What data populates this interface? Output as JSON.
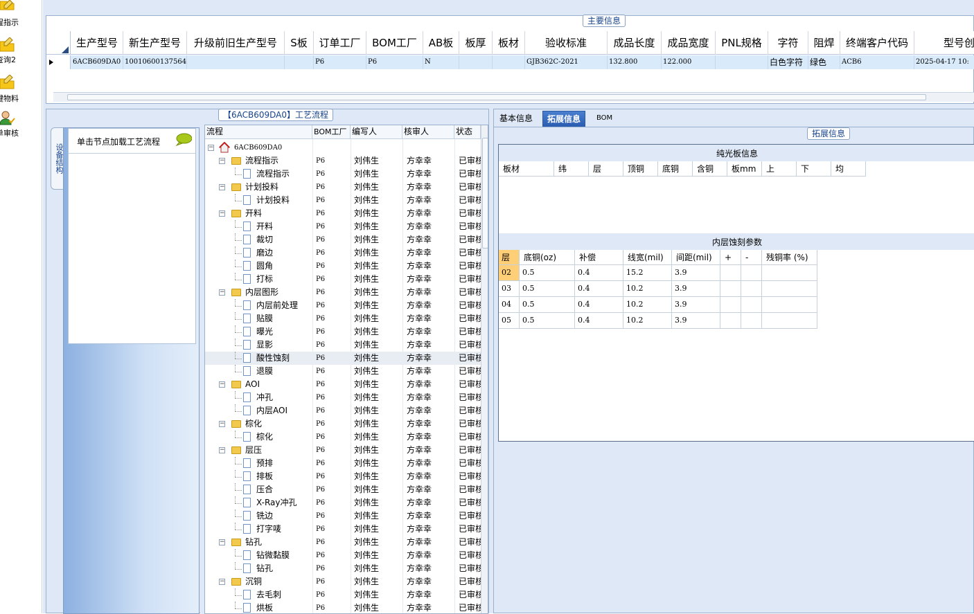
{
  "left_nav": {
    "items": [
      {
        "label": "程指示",
        "icon": "folder-pencil-icon"
      },
      {
        "label": "查询2",
        "icon": "folder-pencil-icon"
      },
      {
        "label": "键物料",
        "icon": "folder-pencil-icon"
      },
      {
        "label": "单审核",
        "icon": "user-check-icon"
      }
    ]
  },
  "main_info": {
    "title": "主要信息",
    "columns": [
      "生产型号",
      "新生产型号",
      "升级前旧生产型号",
      "S板",
      "订单工厂",
      "BOM工厂",
      "AB板",
      "板厚",
      "板材",
      "验收标准",
      "成品长度",
      "成品宽度",
      "PNL规格",
      "字符",
      "阻焊",
      "终端客户代码",
      "型号创"
    ],
    "row": [
      "6ACB609DA0",
      "10010600137564",
      "",
      "",
      "P6",
      "P6",
      "N",
      "",
      "",
      "GJB362C-2021",
      "132.800",
      "122.000",
      "",
      "白色字符",
      "绿色",
      "ACB6",
      "2025-04-17 10:"
    ]
  },
  "process_panel": {
    "title": "【6ACB609DA0】工艺流程",
    "side_tab": "设备结构",
    "hint": "单击节点加载工艺流程",
    "columns": [
      "流程",
      "BOM工厂",
      "编写人",
      "核审人",
      "状态"
    ],
    "rows": [
      {
        "name": "6ACB609DA0",
        "level": 0,
        "type": "root",
        "bom": "",
        "writer": "",
        "reviewer": "",
        "status": ""
      },
      {
        "name": "流程指示",
        "level": 1,
        "type": "folder",
        "bom": "P6",
        "writer": "刘伟生",
        "reviewer": "方幸幸",
        "status": "已审核"
      },
      {
        "name": "流程指示",
        "level": 2,
        "type": "doc",
        "bom": "P6",
        "writer": "刘伟生",
        "reviewer": "方幸幸",
        "status": "已审核"
      },
      {
        "name": "计划投料",
        "level": 1,
        "type": "folder",
        "bom": "P6",
        "writer": "刘伟生",
        "reviewer": "方幸幸",
        "status": "已审核"
      },
      {
        "name": "计划投料",
        "level": 2,
        "type": "doc",
        "bom": "P6",
        "writer": "刘伟生",
        "reviewer": "方幸幸",
        "status": "已审核"
      },
      {
        "name": "开料",
        "level": 1,
        "type": "folder",
        "bom": "P6",
        "writer": "刘伟生",
        "reviewer": "方幸幸",
        "status": "已审核"
      },
      {
        "name": "开料",
        "level": 2,
        "type": "doc",
        "bom": "P6",
        "writer": "刘伟生",
        "reviewer": "方幸幸",
        "status": "已审核"
      },
      {
        "name": "裁切",
        "level": 2,
        "type": "doc",
        "bom": "P6",
        "writer": "刘伟生",
        "reviewer": "方幸幸",
        "status": "已审核"
      },
      {
        "name": "磨边",
        "level": 2,
        "type": "doc",
        "bom": "P6",
        "writer": "刘伟生",
        "reviewer": "方幸幸",
        "status": "已审核"
      },
      {
        "name": "圆角",
        "level": 2,
        "type": "doc",
        "bom": "P6",
        "writer": "刘伟生",
        "reviewer": "方幸幸",
        "status": "已审核"
      },
      {
        "name": "打标",
        "level": 2,
        "type": "doc",
        "bom": "P6",
        "writer": "刘伟生",
        "reviewer": "方幸幸",
        "status": "已审核"
      },
      {
        "name": "内层图形",
        "level": 1,
        "type": "folder",
        "bom": "P6",
        "writer": "刘伟生",
        "reviewer": "方幸幸",
        "status": "已审核"
      },
      {
        "name": "内层前处理",
        "level": 2,
        "type": "doc",
        "bom": "P6",
        "writer": "刘伟生",
        "reviewer": "方幸幸",
        "status": "已审核"
      },
      {
        "name": "贴膜",
        "level": 2,
        "type": "doc",
        "bom": "P6",
        "writer": "刘伟生",
        "reviewer": "方幸幸",
        "status": "已审核"
      },
      {
        "name": "曝光",
        "level": 2,
        "type": "doc",
        "bom": "P6",
        "writer": "刘伟生",
        "reviewer": "方幸幸",
        "status": "已审核"
      },
      {
        "name": "显影",
        "level": 2,
        "type": "doc",
        "bom": "P6",
        "writer": "刘伟生",
        "reviewer": "方幸幸",
        "status": "已审核"
      },
      {
        "name": "酸性蚀刻",
        "level": 2,
        "type": "doc",
        "bom": "P6",
        "writer": "刘伟生",
        "reviewer": "方幸幸",
        "status": "已审核",
        "selected": true
      },
      {
        "name": "退膜",
        "level": 2,
        "type": "doc",
        "bom": "P6",
        "writer": "刘伟生",
        "reviewer": "方幸幸",
        "status": "已审核"
      },
      {
        "name": "AOI",
        "level": 1,
        "type": "folder",
        "bom": "P6",
        "writer": "刘伟生",
        "reviewer": "方幸幸",
        "status": "已审核"
      },
      {
        "name": "冲孔",
        "level": 2,
        "type": "doc",
        "bom": "P6",
        "writer": "刘伟生",
        "reviewer": "方幸幸",
        "status": "已审核"
      },
      {
        "name": "内层AOI",
        "level": 2,
        "type": "doc",
        "bom": "P6",
        "writer": "刘伟生",
        "reviewer": "方幸幸",
        "status": "已审核"
      },
      {
        "name": "棕化",
        "level": 1,
        "type": "folder",
        "bom": "P6",
        "writer": "刘伟生",
        "reviewer": "方幸幸",
        "status": "已审核"
      },
      {
        "name": "棕化",
        "level": 2,
        "type": "doc",
        "bom": "P6",
        "writer": "刘伟生",
        "reviewer": "方幸幸",
        "status": "已审核"
      },
      {
        "name": "层压",
        "level": 1,
        "type": "folder",
        "bom": "P6",
        "writer": "刘伟生",
        "reviewer": "方幸幸",
        "status": "已审核"
      },
      {
        "name": "预排",
        "level": 2,
        "type": "doc",
        "bom": "P6",
        "writer": "刘伟生",
        "reviewer": "方幸幸",
        "status": "已审核"
      },
      {
        "name": "排板",
        "level": 2,
        "type": "doc",
        "bom": "P6",
        "writer": "刘伟生",
        "reviewer": "方幸幸",
        "status": "已审核"
      },
      {
        "name": "压合",
        "level": 2,
        "type": "doc",
        "bom": "P6",
        "writer": "刘伟生",
        "reviewer": "方幸幸",
        "status": "已审核"
      },
      {
        "name": "X-Ray冲孔",
        "level": 2,
        "type": "doc",
        "bom": "P6",
        "writer": "刘伟生",
        "reviewer": "方幸幸",
        "status": "已审核"
      },
      {
        "name": "铣边",
        "level": 2,
        "type": "doc",
        "bom": "P6",
        "writer": "刘伟生",
        "reviewer": "方幸幸",
        "status": "已审核"
      },
      {
        "name": "打字唛",
        "level": 2,
        "type": "doc",
        "bom": "P6",
        "writer": "刘伟生",
        "reviewer": "方幸幸",
        "status": "已审核"
      },
      {
        "name": "钻孔",
        "level": 1,
        "type": "folder",
        "bom": "P6",
        "writer": "刘伟生",
        "reviewer": "方幸幸",
        "status": "已审核"
      },
      {
        "name": "钻微黏膜",
        "level": 2,
        "type": "doc",
        "bom": "P6",
        "writer": "刘伟生",
        "reviewer": "方幸幸",
        "status": "已审核"
      },
      {
        "name": "钻孔",
        "level": 2,
        "type": "doc",
        "bom": "P6",
        "writer": "刘伟生",
        "reviewer": "方幸幸",
        "status": "已审核"
      },
      {
        "name": "沉铜",
        "level": 1,
        "type": "folder",
        "bom": "P6",
        "writer": "刘伟生",
        "reviewer": "方幸幸",
        "status": "已审核"
      },
      {
        "name": "去毛刺",
        "level": 2,
        "type": "doc",
        "bom": "P6",
        "writer": "刘伟生",
        "reviewer": "方幸幸",
        "status": "已审核"
      },
      {
        "name": "烘板",
        "level": 2,
        "type": "doc",
        "bom": "P6",
        "writer": "刘伟生",
        "reviewer": "方幸幸",
        "status": "已审核"
      }
    ]
  },
  "right_panel": {
    "tabs": [
      "基本信息",
      "拓展信息",
      "BOM"
    ],
    "active_tab": "拓展信息",
    "group_title": "拓展信息",
    "bare_board": {
      "title": "纯光板信息",
      "columns": [
        "板材",
        "纬",
        "层",
        "顶铜",
        "底铜",
        "含铜",
        "板mm",
        "上",
        "下",
        "均"
      ]
    },
    "inner_etch": {
      "title": "内层蚀刻参数",
      "columns": [
        "层",
        "底铜(oz)",
        "补偿",
        "线宽(mil)",
        "间距(mil)",
        "+",
        "-",
        "残铜率 (%)"
      ],
      "rows": [
        [
          "02",
          "0.5",
          "0.4",
          "15.2",
          "3.9",
          "",
          "",
          ""
        ],
        [
          "03",
          "0.5",
          "0.4",
          "10.2",
          "3.9",
          "",
          "",
          ""
        ],
        [
          "04",
          "0.5",
          "0.4",
          "10.2",
          "3.9",
          "",
          "",
          ""
        ],
        [
          "05",
          "0.5",
          "0.4",
          "10.2",
          "3.9",
          "",
          "",
          ""
        ]
      ]
    }
  }
}
